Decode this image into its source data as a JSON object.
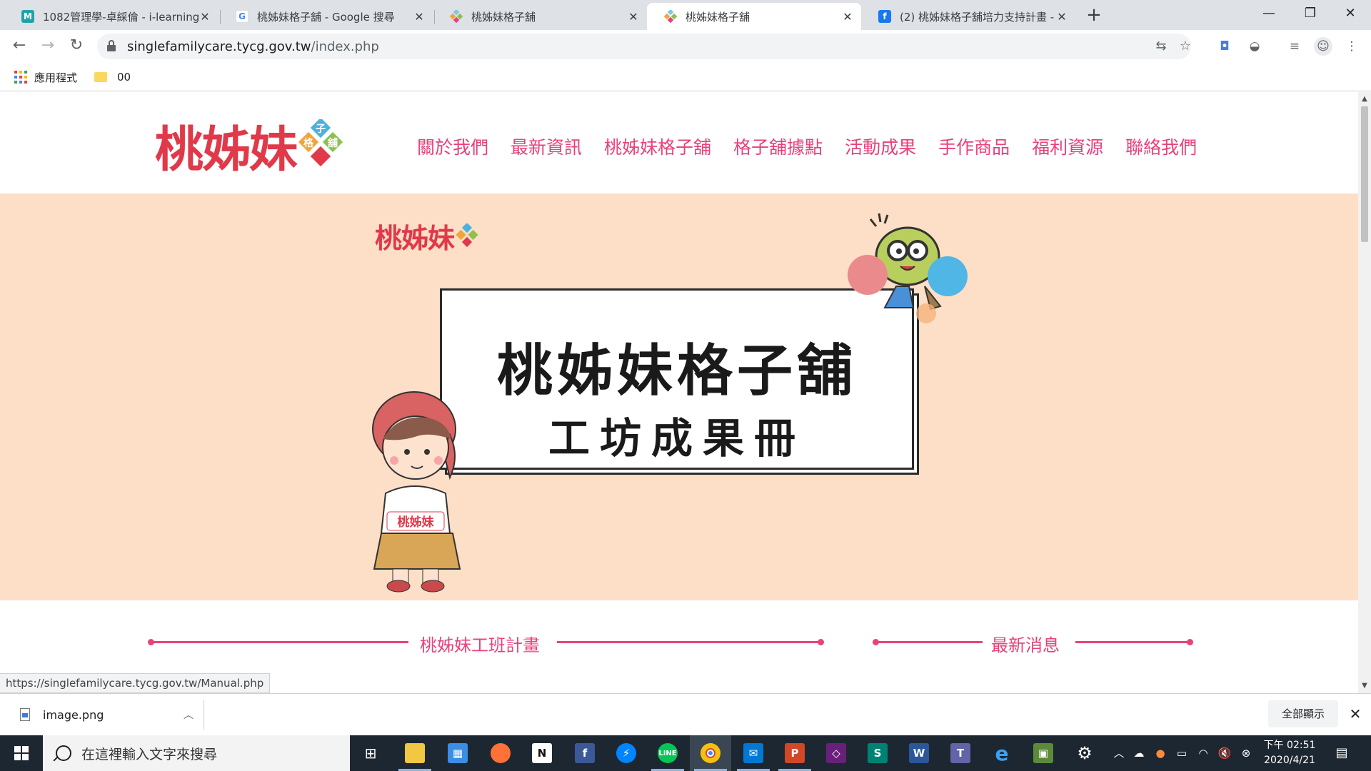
{
  "browser": {
    "tabs": [
      {
        "title": "1082管理學-卓綵倫 - i-learning",
        "favicon": "M",
        "favicon_color": "#20a3a8",
        "active": false
      },
      {
        "title": "桃姊妹格子舖 - Google 搜尋",
        "favicon": "G",
        "favicon_color": "#4285f4",
        "active": false
      },
      {
        "title": "桃姊妹格子舖",
        "favicon": "diamond",
        "favicon_color": "#e8417c",
        "active": false
      },
      {
        "title": "桃姊妹格子舖",
        "favicon": "diamond",
        "favicon_color": "#e8417c",
        "active": true
      },
      {
        "title": "(2) 桃姊妹格子舖培力支持計畫 -",
        "favicon": "f",
        "favicon_color": "#1877f2",
        "active": false
      }
    ],
    "new_tab_label": "+",
    "window_controls": {
      "minimize": "—",
      "restore": "❐",
      "close": "✕"
    },
    "url": {
      "domain": "singlefamilycare.tycg.gov.tw",
      "path": "/index.php"
    },
    "bookmarks": [
      {
        "label": "應用程式",
        "icon": "apps-grid-icon"
      },
      {
        "label": "00",
        "icon": "folder-icon"
      }
    ]
  },
  "site": {
    "logo_text": "桃姊妹",
    "logo_badge": [
      "子",
      "格",
      "舖"
    ],
    "nav": [
      "關於我們",
      "最新資訊",
      "桃姊妹格子舖",
      "格子舖據點",
      "活動成果",
      "手作商品",
      "福利資源",
      "聯絡我們"
    ],
    "hero": {
      "logo_text": "桃姊妹",
      "title": "桃姊妹格子舖",
      "subtitle": "工坊成果冊",
      "character_shirt_text": "桃姊妹",
      "background": "#fddec6"
    },
    "sections": [
      {
        "title": "桃姊妹工班計畫"
      },
      {
        "title": "最新消息"
      }
    ],
    "accent_color": "#e8417c"
  },
  "status_bar_url": "https://singlefamilycare.tycg.gov.tw/Manual.php",
  "download_shelf": {
    "file_name": "image.png",
    "show_all_label": "全部顯示"
  },
  "taskbar": {
    "search_placeholder": "在這裡輸入文字來搜尋",
    "apps": [
      {
        "name": "task-view",
        "glyph": "⊞",
        "color": "transparent"
      },
      {
        "name": "file-explorer",
        "glyph": "▬",
        "color": "#f2c744"
      },
      {
        "name": "microsoft-store",
        "glyph": "▦",
        "color": "#3a8ee6"
      },
      {
        "name": "firefox",
        "glyph": "●",
        "color": "#ff7139"
      },
      {
        "name": "notion",
        "glyph": "N",
        "color": "#222222"
      },
      {
        "name": "facebook",
        "glyph": "f",
        "color": "#3b5998"
      },
      {
        "name": "messenger",
        "glyph": "✦",
        "color": "#0084ff"
      },
      {
        "name": "line",
        "glyph": "L",
        "color": "#06c755"
      },
      {
        "name": "chrome",
        "glyph": "◉",
        "color": "#db4437"
      },
      {
        "name": "mail",
        "glyph": "✉",
        "color": "#0078d4"
      },
      {
        "name": "powerpoint",
        "glyph": "P",
        "color": "#d24726"
      },
      {
        "name": "visual-studio",
        "glyph": "◇",
        "color": "#68217a"
      },
      {
        "name": "sway",
        "glyph": "S",
        "color": "#008272"
      },
      {
        "name": "word",
        "glyph": "W",
        "color": "#2b579a"
      },
      {
        "name": "teams",
        "glyph": "T",
        "color": "#6264a7"
      },
      {
        "name": "edge",
        "glyph": "e",
        "color": "#0078d7"
      },
      {
        "name": "minecraft",
        "glyph": "▣",
        "color": "#5d8a3a"
      },
      {
        "name": "settings",
        "glyph": "⚙",
        "color": "transparent"
      }
    ],
    "clock_time": "下午 02:51",
    "clock_date": "2020/4/21"
  }
}
